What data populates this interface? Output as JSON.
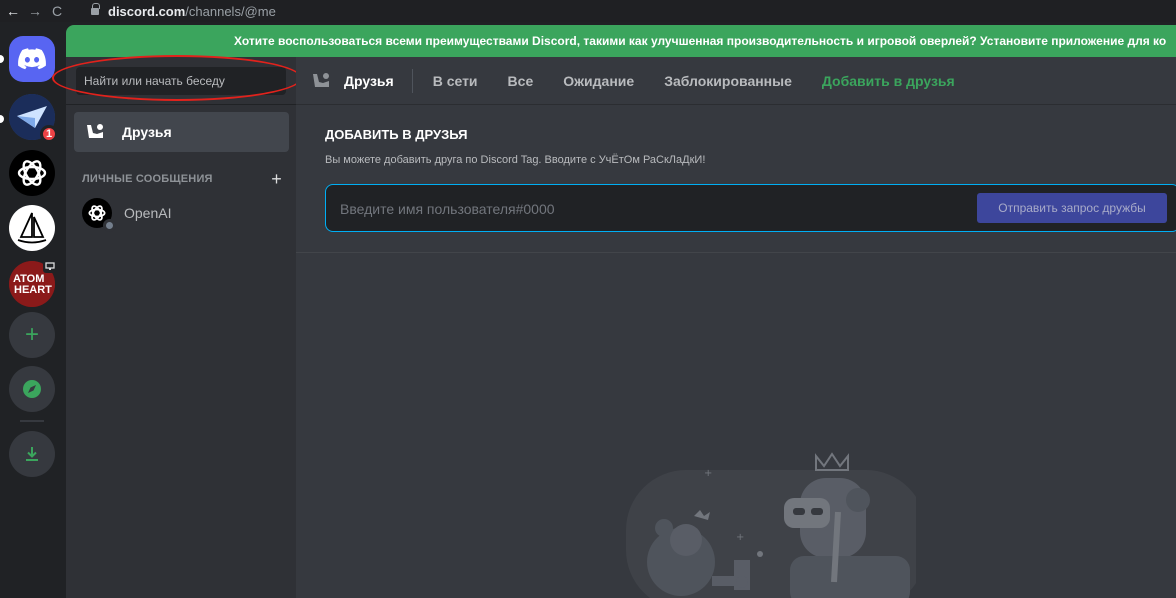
{
  "browser": {
    "back": "←",
    "forward": "→",
    "reload": "C",
    "domain": "discord.com",
    "path": "/channels/@me"
  },
  "servers": {
    "home_badge": "1"
  },
  "banner": {
    "text": "Хотите воспользоваться всеми преимуществами Discord, такими как улучшенная производительность и игровой оверлей? Установите приложение для ко"
  },
  "sidebar": {
    "search_placeholder": "Найти или начать беседу",
    "friends_label": "Друзья",
    "dm_header": "ЛИЧНЫЕ СООБЩЕНИЯ",
    "dm_add": "+",
    "dm_items": [
      {
        "name": "OpenAI"
      }
    ]
  },
  "topbar": {
    "title": "Друзья",
    "tabs": {
      "online": "В сети",
      "all": "Все",
      "pending": "Ожидание",
      "blocked": "Заблокированные",
      "add": "Добавить в друзья"
    }
  },
  "add_friend": {
    "title": "ДОБАВИТЬ В ДРУЗЬЯ",
    "description": "Вы можете добавить друга по Discord Tag. Вводите с УчЁтОм РаСкЛаДкИ!",
    "placeholder": "Введите имя пользователя#0000",
    "button": "Отправить запрос дружбы"
  },
  "server_labels": {
    "atomic_heart_line1": "ATOM",
    "atomic_heart_line2": "HEART"
  },
  "colors": {
    "blurple": "#5865f2",
    "green": "#3ba55d",
    "annotation_red": "#e2221c"
  }
}
